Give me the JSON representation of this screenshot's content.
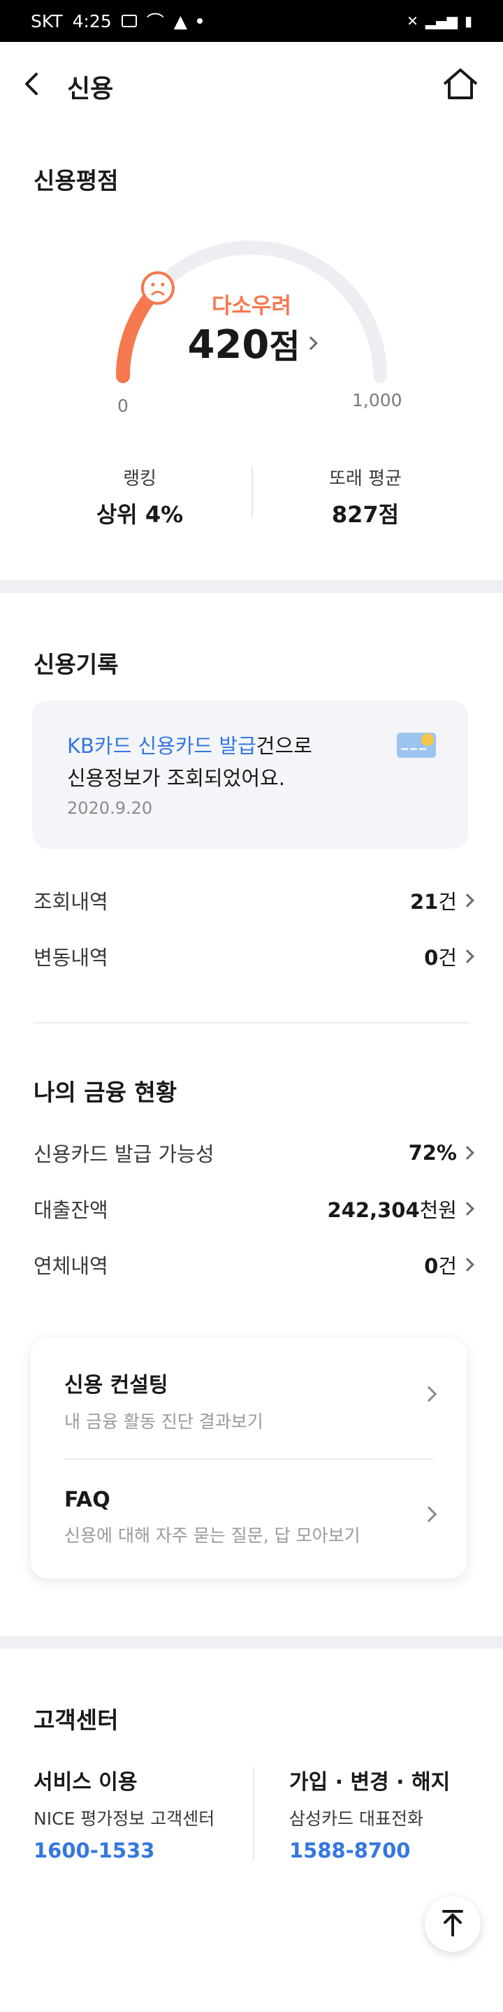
{
  "status_bar": {
    "carrier": "SKT",
    "time": "4:25"
  },
  "header": {
    "title": "신용"
  },
  "credit_score": {
    "section_title": "신용평점",
    "status": "다소우려",
    "score": "420",
    "unit": "점",
    "min": "0",
    "max": "1,000",
    "score_fraction": 0.42,
    "ranking_label": "랭킹",
    "ranking_value": "상위 4%",
    "peer_label": "또래 평균",
    "peer_value": "827점",
    "colors": {
      "accent": "#f5784f",
      "track": "#eceef2"
    }
  },
  "credit_record": {
    "section_title": "신용기록",
    "card": {
      "highlight": "KB카드 신용카드 발급",
      "text_after": "건으로",
      "line2": "신용정보가 조회되었어요.",
      "date": "2020.9.20"
    },
    "rows": [
      {
        "label": "조회내역",
        "value": "21",
        "unit": "건"
      },
      {
        "label": "변동내역",
        "value": "0",
        "unit": "건"
      }
    ]
  },
  "finance": {
    "section_title": "나의 금융 현황",
    "rows": [
      {
        "label": "신용카드 발급 가능성",
        "value": "72%",
        "unit": ""
      },
      {
        "label": "대출잔액",
        "value": "242,304",
        "unit": "천원"
      },
      {
        "label": "연체내역",
        "value": "0",
        "unit": "건"
      }
    ]
  },
  "consulting": {
    "items": [
      {
        "title": "신용 컨설팅",
        "subtitle": "내 금융 활동 진단 결과보기"
      },
      {
        "title": "FAQ",
        "subtitle": "신용에 대해 자주 묻는 질문, 답 모아보기"
      }
    ]
  },
  "customer_center": {
    "section_title": "고객센터",
    "blocks": [
      {
        "title": "서비스 이용",
        "subtitle": "NICE 평가정보 고객센터",
        "phone": "1600-1533"
      },
      {
        "title": "가입 · 변경 · 해지",
        "subtitle": "삼성카드 대표전화",
        "phone": "1588-8700"
      }
    ]
  }
}
